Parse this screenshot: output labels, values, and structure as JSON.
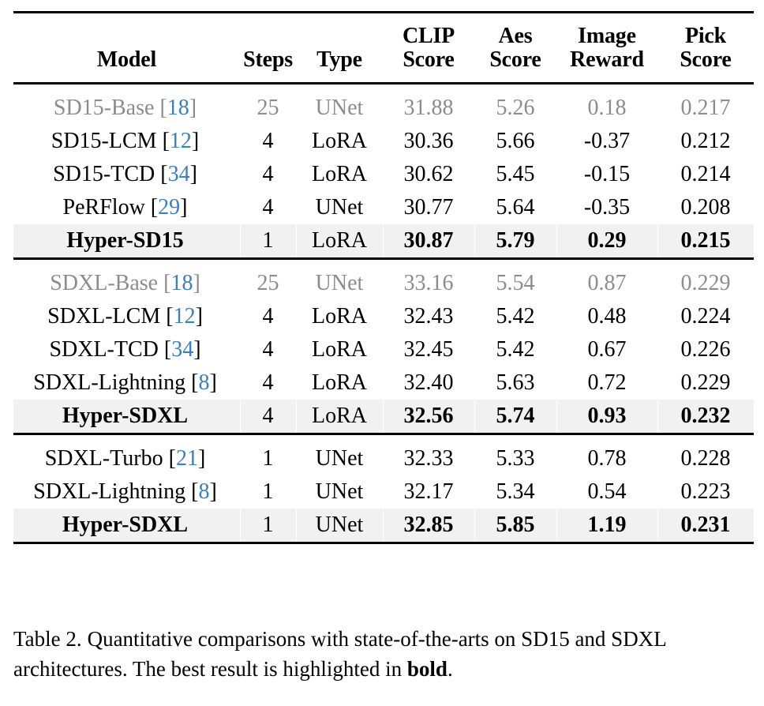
{
  "table": {
    "columns": [
      {
        "key": "model",
        "line1": "Model",
        "line2": "",
        "align": "center"
      },
      {
        "key": "steps",
        "line1": "Steps",
        "line2": "",
        "align": "center"
      },
      {
        "key": "type",
        "line1": "Type",
        "line2": "",
        "align": "center"
      },
      {
        "key": "clip",
        "line1": "CLIP",
        "line2": "Score",
        "align": "center"
      },
      {
        "key": "aes",
        "line1": "Aes",
        "line2": "Score",
        "align": "center"
      },
      {
        "key": "reward",
        "line1": "Image",
        "line2": "Reward",
        "align": "center"
      },
      {
        "key": "pick",
        "line1": "Pick",
        "line2": "Score",
        "align": "center"
      }
    ],
    "sections": [
      {
        "id": "sd15",
        "rows": [
          {
            "model": "SD15-Base",
            "cite": "18",
            "steps": "25",
            "type": "UNet",
            "clip": "31.88",
            "aes": "5.26",
            "reward": "0.18",
            "pick": "0.217",
            "style": "muted"
          },
          {
            "model": "SD15-LCM",
            "cite": "12",
            "steps": "4",
            "type": "LoRA",
            "clip": "30.36",
            "aes": "5.66",
            "reward": "-0.37",
            "pick": "0.212",
            "style": "normal"
          },
          {
            "model": "SD15-TCD",
            "cite": "34",
            "steps": "4",
            "type": "LoRA",
            "clip": "30.62",
            "aes": "5.45",
            "reward": "-0.15",
            "pick": "0.214",
            "style": "normal"
          },
          {
            "model": "PeRFlow",
            "cite": "29",
            "steps": "4",
            "type": "UNet",
            "clip": "30.77",
            "aes": "5.64",
            "reward": "-0.35",
            "pick": "0.208",
            "style": "normal"
          },
          {
            "model": "Hyper-SD15",
            "cite": "",
            "steps": "1",
            "type": "LoRA",
            "clip": "30.87",
            "aes": "5.79",
            "reward": "0.29",
            "pick": "0.215",
            "style": "best"
          }
        ]
      },
      {
        "id": "sdxl-4step",
        "rows": [
          {
            "model": "SDXL-Base",
            "cite": "18",
            "steps": "25",
            "type": "UNet",
            "clip": "33.16",
            "aes": "5.54",
            "reward": "0.87",
            "pick": "0.229",
            "style": "muted"
          },
          {
            "model": "SDXL-LCM",
            "cite": "12",
            "steps": "4",
            "type": "LoRA",
            "clip": "32.43",
            "aes": "5.42",
            "reward": "0.48",
            "pick": "0.224",
            "style": "normal"
          },
          {
            "model": "SDXL-TCD",
            "cite": "34",
            "steps": "4",
            "type": "LoRA",
            "clip": "32.45",
            "aes": "5.42",
            "reward": "0.67",
            "pick": "0.226",
            "style": "normal"
          },
          {
            "model": "SDXL-Lightning",
            "cite": "8",
            "steps": "4",
            "type": "LoRA",
            "clip": "32.40",
            "aes": "5.63",
            "reward": "0.72",
            "pick": "0.229",
            "style": "normal"
          },
          {
            "model": "Hyper-SDXL",
            "cite": "",
            "steps": "4",
            "type": "LoRA",
            "clip": "32.56",
            "aes": "5.74",
            "reward": "0.93",
            "pick": "0.232",
            "style": "best"
          }
        ]
      },
      {
        "id": "sdxl-1step",
        "rows": [
          {
            "model": "SDXL-Turbo",
            "cite": "21",
            "steps": "1",
            "type": "UNet",
            "clip": "32.33",
            "aes": "5.33",
            "reward": "0.78",
            "pick": "0.228",
            "style": "normal"
          },
          {
            "model": "SDXL-Lightning",
            "cite": "8",
            "steps": "1",
            "type": "UNet",
            "clip": "32.17",
            "aes": "5.34",
            "reward": "0.54",
            "pick": "0.223",
            "style": "normal"
          },
          {
            "model": "Hyper-SDXL",
            "cite": "",
            "steps": "1",
            "type": "UNet",
            "clip": "32.85",
            "aes": "5.85",
            "reward": "1.19",
            "pick": "0.231",
            "style": "best"
          }
        ]
      }
    ]
  },
  "caption": {
    "label": "Table 2.",
    "text_before_bold": "Quantitative comparisons with state-of-the-arts on SD15 and SDXL architectures. The best result is highlighted in ",
    "bold_word": "bold",
    "text_after_bold": "."
  },
  "colors": {
    "citation_blue": "#3a7fbe",
    "muted_gray": "#8c8c8c",
    "highlight_row": "#f1f1f1",
    "rule_black": "#000000",
    "page_background": "#ffffff"
  }
}
